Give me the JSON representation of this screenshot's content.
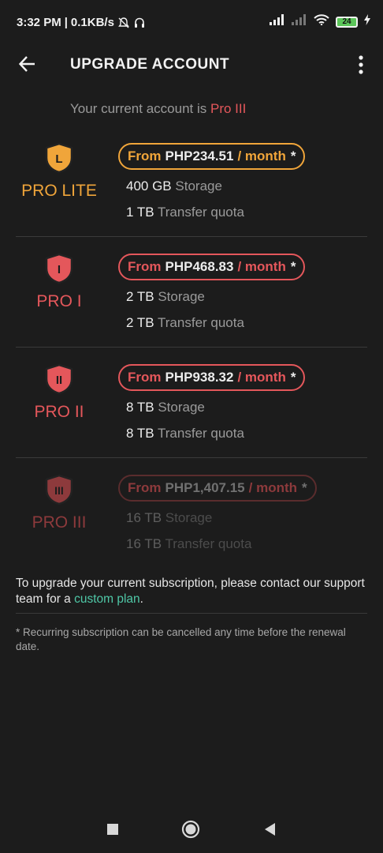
{
  "status_bar": {
    "time": "3:32 PM",
    "speed": "0.1KB/s",
    "battery": "24",
    "icons": [
      "bell-off-icon",
      "headset-icon",
      "signal-icon",
      "signal-icon-2",
      "wifi-icon",
      "battery-icon",
      "charging-icon"
    ]
  },
  "app_bar": {
    "title": "UPGRADE ACCOUNT",
    "back_icon": "arrow-left-icon",
    "menu_icon": "more-vertical-icon"
  },
  "current_account": {
    "prefix": "Your current account is",
    "plan": "Pro III"
  },
  "plans": [
    {
      "name": "PRO LITE",
      "badge_letter": "L",
      "price_prefix": "From",
      "price": "PHP234.51",
      "period": "/ month",
      "asterisk": "*",
      "storage_value": "400 GB",
      "storage_label": "Storage",
      "transfer_value": "1 TB",
      "transfer_label": "Transfer quota",
      "color": "#f0a53a"
    },
    {
      "name": "PRO I",
      "badge_letter": "I",
      "price_prefix": "From",
      "price": "PHP468.83",
      "period": "/ month",
      "asterisk": "*",
      "storage_value": "2 TB",
      "storage_label": "Storage",
      "transfer_value": "2 TB",
      "transfer_label": "Transfer quota",
      "color": "#e4575b"
    },
    {
      "name": "PRO II",
      "badge_letter": "II",
      "price_prefix": "From",
      "price": "PHP938.32",
      "period": "/ month",
      "asterisk": "*",
      "storage_value": "8 TB",
      "storage_label": "Storage",
      "transfer_value": "8 TB",
      "transfer_label": "Transfer quota",
      "color": "#e4575b"
    },
    {
      "name": "PRO III",
      "badge_letter": "III",
      "price_prefix": "From",
      "price": "PHP1,407.15",
      "period": "/ month",
      "asterisk": "*",
      "storage_value": "16 TB",
      "storage_label": "Storage",
      "transfer_value": "16 TB",
      "transfer_label": "Transfer quota",
      "color": "#8d3a3c"
    }
  ],
  "upgrade_note": {
    "text": "To upgrade your current subscription, please contact our support team for a",
    "link": "custom plan",
    "suffix": "."
  },
  "footnote": "* Recurring subscription can be cancelled any time before the renewal date.",
  "nav_bar": {
    "icons": [
      "recents-square-icon",
      "home-circle-icon",
      "back-triangle-icon"
    ]
  }
}
